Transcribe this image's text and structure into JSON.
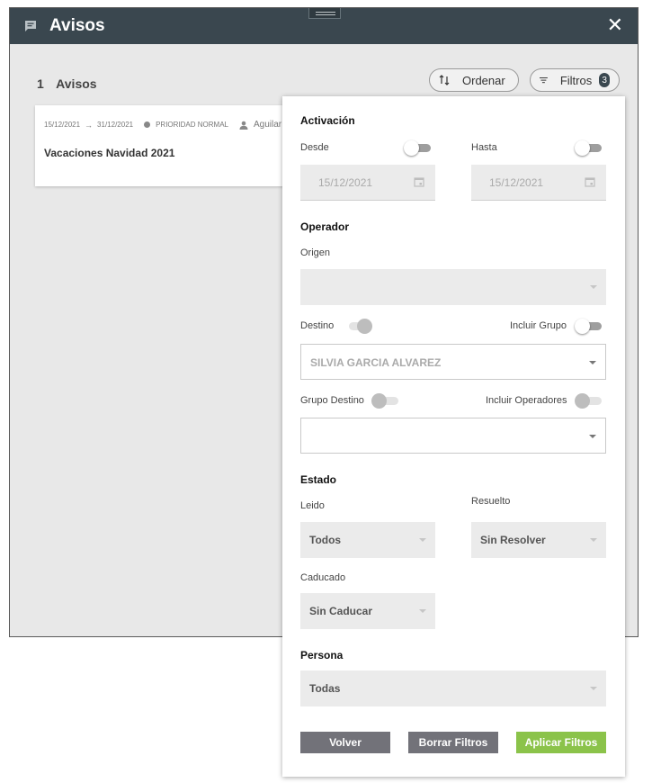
{
  "window": {
    "title": "Avisos",
    "close_label": "✕"
  },
  "list": {
    "count": "1",
    "count_label": "Avisos",
    "order_label": "Ordenar",
    "filters_label": "Filtros",
    "filters_badge": "3",
    "items": [
      {
        "date_from": "15/12/2021",
        "date_to": "31/12/2021",
        "priority": "PRIORIDAD NORMAL",
        "person": "Aguilar",
        "title": "Vacaciones Navidad 2021"
      }
    ]
  },
  "filters": {
    "activation": {
      "title": "Activación",
      "from_label": "Desde",
      "from_value": "15/12/2021",
      "to_label": "Hasta",
      "to_value": "15/12/2021"
    },
    "operator": {
      "title": "Operador",
      "origin_label": "Origen",
      "origin_value": "",
      "dest_label": "Destino",
      "include_group_label": "Incluir Grupo",
      "dest_value": "SILVIA GARCIA ALVAREZ",
      "dest_group_label": "Grupo Destino",
      "include_operators_label": "Incluir Operadores",
      "dest_group_value": ""
    },
    "state": {
      "title": "Estado",
      "read_label": "Leido",
      "read_value": "Todos",
      "resolved_label": "Resuelto",
      "resolved_value": "Sin Resolver",
      "expired_label": "Caducado",
      "expired_value": "Sin Caducar"
    },
    "person": {
      "title": "Persona",
      "value": "Todas"
    },
    "buttons": {
      "back": "Volver",
      "clear": "Borrar Filtros",
      "apply": "Aplicar Filtros"
    }
  },
  "colors": {
    "titlebar": "#3a474f",
    "apply": "#8bc34a",
    "secondary_button": "#727279"
  }
}
